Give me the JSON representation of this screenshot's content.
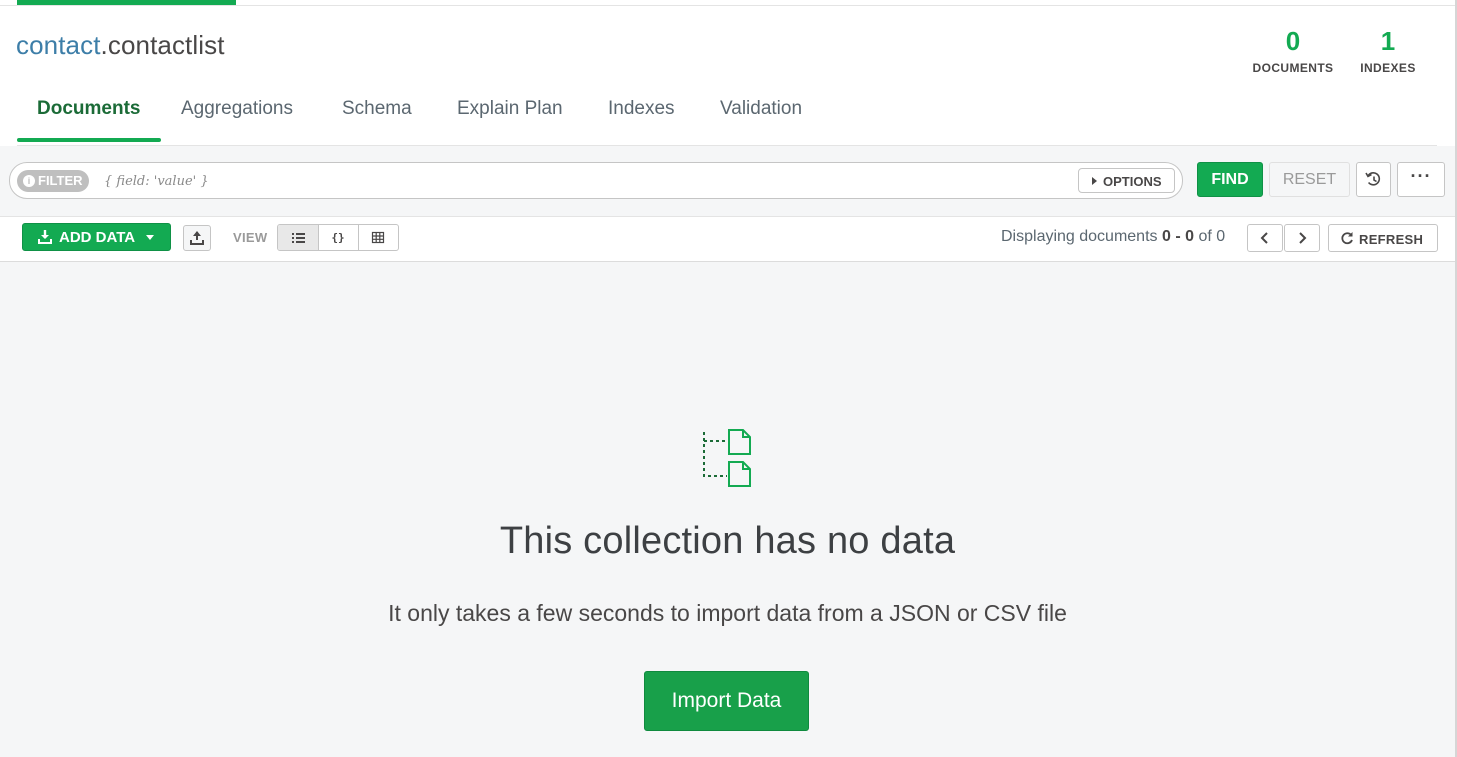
{
  "header": {
    "db_name": "contact",
    "collection_name": ".contactlist",
    "stats": {
      "documents": {
        "count": "0",
        "label": "DOCUMENTS"
      },
      "indexes": {
        "count": "1",
        "label": "INDEXES"
      }
    }
  },
  "tabs": [
    {
      "label": "Documents",
      "active": true
    },
    {
      "label": "Aggregations",
      "active": false
    },
    {
      "label": "Schema",
      "active": false
    },
    {
      "label": "Explain Plan",
      "active": false
    },
    {
      "label": "Indexes",
      "active": false
    },
    {
      "label": "Validation",
      "active": false
    }
  ],
  "querybar": {
    "filter_label": "FILTER",
    "filter_placeholder": "{ field: 'value' }",
    "options_label": "OPTIONS",
    "find_label": "FIND",
    "reset_label": "RESET",
    "more_label": "···"
  },
  "controls": {
    "add_data_label": "ADD DATA",
    "view_label": "VIEW",
    "display_prefix": "Displaying documents",
    "display_range": "0 - 0",
    "display_of": "of 0",
    "refresh_label": "REFRESH",
    "view_options": [
      "list-view",
      "json-view",
      "table-view"
    ],
    "active_view": "list-view"
  },
  "empty_state": {
    "title": "This collection has no data",
    "subtitle": "It only takes a few seconds to import data from a JSON or CSV file",
    "import_button": "Import Data"
  },
  "colors": {
    "accent_green": "#13aa52",
    "db_blue": "#3d7ea8",
    "background": "#f5f6f7"
  }
}
